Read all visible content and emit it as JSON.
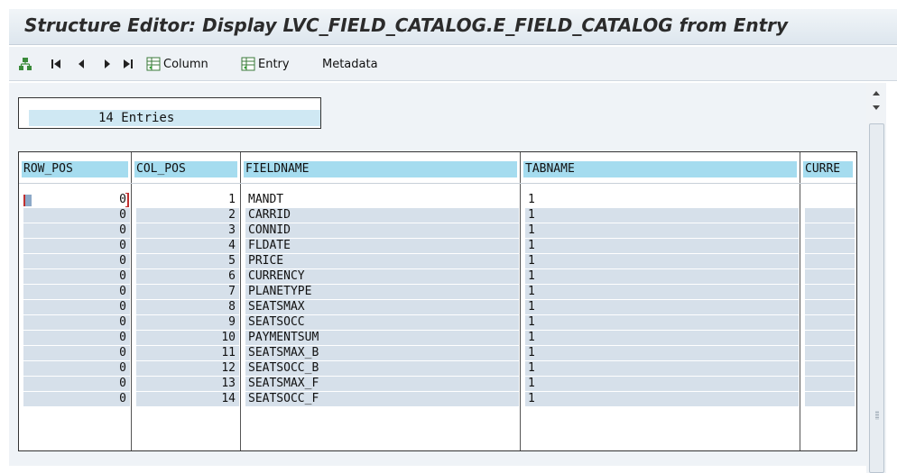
{
  "window": {
    "title": "Structure Editor: Display LVC_FIELD_CATALOG.E_FIELD_CATALOG from Entry"
  },
  "toolbar": {
    "icons": [
      "structure-icon",
      "first-page-icon",
      "previous-page-icon",
      "next-page-icon",
      "last-page-icon"
    ],
    "column_label": "Column",
    "entry_label": "Entry",
    "metadata_label": "Metadata"
  },
  "entries": {
    "count_label": "14 Entries"
  },
  "table": {
    "headers": [
      "ROW_POS",
      "COL_POS",
      "FIELDNAME",
      "TABNAME",
      "CURRE"
    ],
    "rows": [
      [
        "0",
        "1",
        "MANDT",
        "1"
      ],
      [
        "0",
        "2",
        "CARRID",
        "1"
      ],
      [
        "0",
        "3",
        "CONNID",
        "1"
      ],
      [
        "0",
        "4",
        "FLDATE",
        "1"
      ],
      [
        "0",
        "5",
        "PRICE",
        "1"
      ],
      [
        "0",
        "6",
        "CURRENCY",
        "1"
      ],
      [
        "0",
        "7",
        "PLANETYPE",
        "1"
      ],
      [
        "0",
        "8",
        "SEATSMAX",
        "1"
      ],
      [
        "0",
        "9",
        "SEATSOCC",
        "1"
      ],
      [
        "0",
        "10",
        "PAYMENTSUM",
        "1"
      ],
      [
        "0",
        "11",
        "SEATSMAX_B",
        "1"
      ],
      [
        "0",
        "12",
        "SEATSOCC_B",
        "1"
      ],
      [
        "0",
        "13",
        "SEATSMAX_F",
        "1"
      ],
      [
        "0",
        "14",
        "SEATSOCC_F",
        "1"
      ]
    ]
  },
  "colors": {
    "header_accent": "#a5dcef",
    "row_fill": "#d6e0ea",
    "selection": "#c03030"
  }
}
